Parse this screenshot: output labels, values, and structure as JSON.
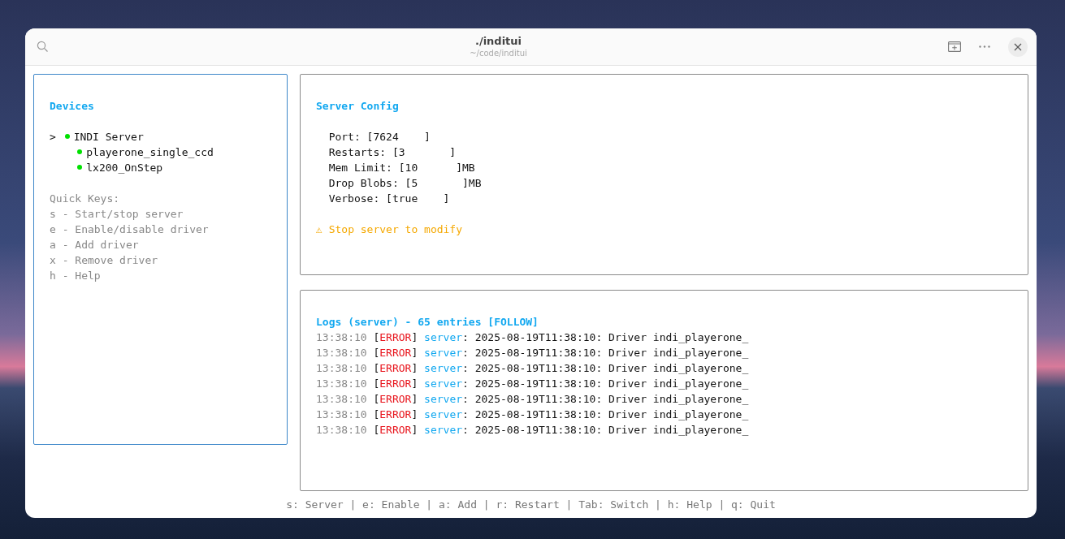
{
  "window": {
    "title": "./inditui",
    "subtitle": "~/code/inditui"
  },
  "devices_panel": {
    "focused": true,
    "title": "Devices",
    "cursor": ">",
    "tree": [
      {
        "name": "INDI Server",
        "selected": true,
        "color": "#00e000",
        "children": [
          {
            "name": "playerone_single_ccd",
            "selected": false,
            "color": "#00e000"
          },
          {
            "name": "lx200_OnStep",
            "selected": false,
            "color": "#00e000"
          }
        ]
      }
    ],
    "quick_keys": [
      "Quick Keys:",
      "s - Start/stop server",
      "e - Enable/disable driver",
      "a - Add driver",
      "x - Remove driver",
      "h - Help"
    ]
  },
  "config_panel": {
    "focused": false,
    "title": "Server Config",
    "fields": [
      "Port: [7624    ]",
      "Restarts: [3       ]",
      "Mem Limit: [10      ]MB",
      "Drop Blobs: [5       ]MB",
      "Verbose: [true    ]"
    ],
    "warning": "⚠ Stop server to modify"
  },
  "logs_panel": {
    "focused": false,
    "title": "Logs (server) - 65 entries [FOLLOW]",
    "lines": [
      [
        {
          "kind": "time",
          "text": "13:38:10 "
        },
        {
          "kind": "plain",
          "text": "["
        },
        {
          "kind": "level",
          "text": "ERROR"
        },
        {
          "kind": "plain",
          "text": "] "
        },
        {
          "kind": "source",
          "text": "server"
        },
        {
          "kind": "plain",
          "text": ": 2025-08-19T11:38:10: Driver indi_playerone_"
        }
      ],
      [
        {
          "kind": "time",
          "text": "13:38:10 "
        },
        {
          "kind": "plain",
          "text": "["
        },
        {
          "kind": "level",
          "text": "ERROR"
        },
        {
          "kind": "plain",
          "text": "] "
        },
        {
          "kind": "source",
          "text": "server"
        },
        {
          "kind": "plain",
          "text": ": 2025-08-19T11:38:10: Driver indi_playerone_"
        }
      ],
      [
        {
          "kind": "time",
          "text": "13:38:10 "
        },
        {
          "kind": "plain",
          "text": "["
        },
        {
          "kind": "level",
          "text": "ERROR"
        },
        {
          "kind": "plain",
          "text": "] "
        },
        {
          "kind": "source",
          "text": "server"
        },
        {
          "kind": "plain",
          "text": ": 2025-08-19T11:38:10: Driver indi_playerone_"
        }
      ],
      [
        {
          "kind": "time",
          "text": "13:38:10 "
        },
        {
          "kind": "plain",
          "text": "["
        },
        {
          "kind": "level",
          "text": "ERROR"
        },
        {
          "kind": "plain",
          "text": "] "
        },
        {
          "kind": "source",
          "text": "server"
        },
        {
          "kind": "plain",
          "text": ": 2025-08-19T11:38:10: Driver indi_playerone_"
        }
      ],
      [
        {
          "kind": "time",
          "text": "13:38:10 "
        },
        {
          "kind": "plain",
          "text": "["
        },
        {
          "kind": "level",
          "text": "ERROR"
        },
        {
          "kind": "plain",
          "text": "] "
        },
        {
          "kind": "source",
          "text": "server"
        },
        {
          "kind": "plain",
          "text": ": 2025-08-19T11:38:10: Driver indi_playerone_"
        }
      ],
      [
        {
          "kind": "time",
          "text": "13:38:10 "
        },
        {
          "kind": "plain",
          "text": "["
        },
        {
          "kind": "level",
          "text": "ERROR"
        },
        {
          "kind": "plain",
          "text": "] "
        },
        {
          "kind": "source",
          "text": "server"
        },
        {
          "kind": "plain",
          "text": ": 2025-08-19T11:38:10: Driver indi_playerone_"
        }
      ],
      [
        {
          "kind": "time",
          "text": "13:38:10 "
        },
        {
          "kind": "plain",
          "text": "["
        },
        {
          "kind": "level",
          "text": "ERROR"
        },
        {
          "kind": "plain",
          "text": "] "
        },
        {
          "kind": "source",
          "text": "server"
        },
        {
          "kind": "plain",
          "text": ": 2025-08-19T11:38:10: Driver indi_playerone_"
        }
      ]
    ]
  },
  "status_bar": "s: Server | e: Enable | a: Add | r: Restart | Tab: Switch | h: Help | q: Quit"
}
